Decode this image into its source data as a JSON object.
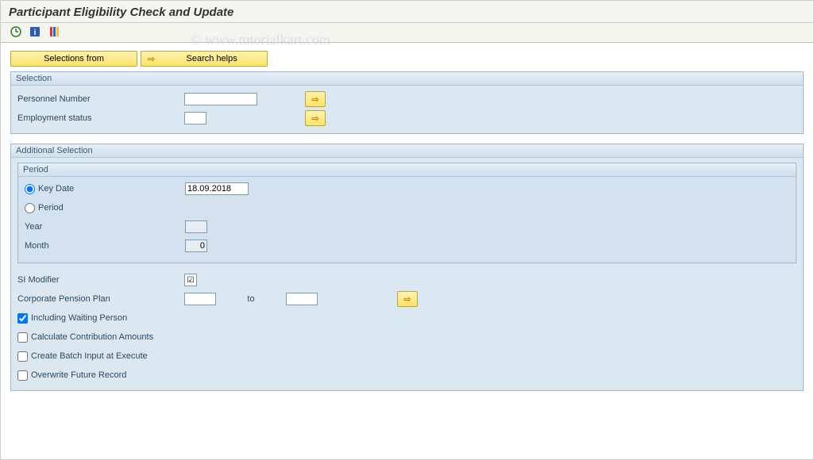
{
  "title": "Participant Eligibility Check and Update",
  "watermark": "© www.tutorialkart.com",
  "buttons": {
    "selections_from": "Selections from",
    "search_helps": "Search helps"
  },
  "selection": {
    "title": "Selection",
    "personnel_number_label": "Personnel Number",
    "personnel_number_value": "",
    "employment_status_label": "Employment status",
    "employment_status_value": ""
  },
  "additional": {
    "title": "Additional Selection",
    "period_box_title": "Period",
    "key_date_label": "Key Date",
    "key_date_value": "18.09.2018",
    "period_label": "Period",
    "year_label": "Year",
    "year_value": "",
    "month_label": "Month",
    "month_value": "0",
    "si_modifier_label": "SI Modifier",
    "corporate_pension_label": "Corporate Pension Plan",
    "corporate_pension_from": "",
    "to_label": "to",
    "corporate_pension_to": "",
    "including_waiting_label": "Including Waiting Person",
    "calculate_contribution_label": "Calculate Contribution Amounts",
    "create_batch_label": "Create Batch Input at Execute",
    "overwrite_future_label": "Overwrite Future Record"
  }
}
